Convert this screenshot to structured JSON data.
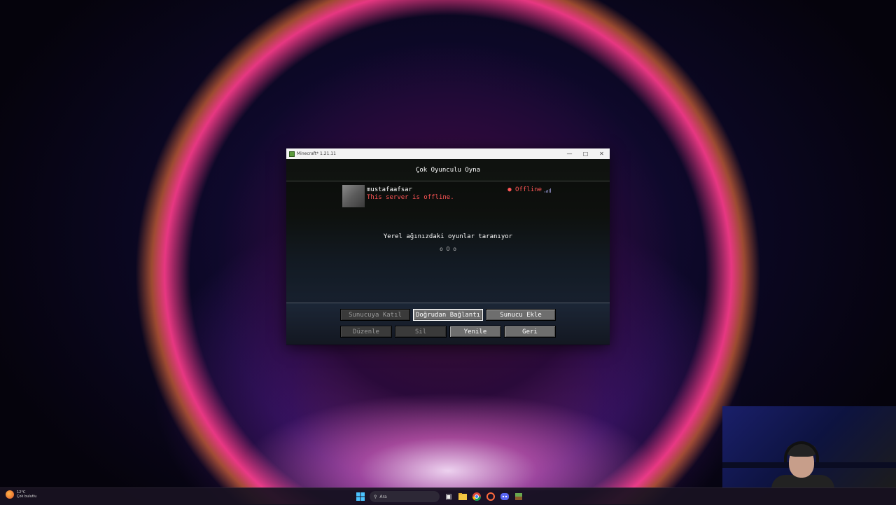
{
  "window": {
    "title": "Minecraft* 1.21.11",
    "minimize": "—",
    "maximize": "□",
    "close": "✕"
  },
  "minecraft": {
    "header": "Çok Oyunculu Oyna",
    "server": {
      "name": "mustafaafsar",
      "motd": "This server is offline.",
      "status": "● Offline"
    },
    "scanning_text": "Yerel ağınızdaki oyunlar taranıyor",
    "scanning_dots": "o O o",
    "buttons": {
      "join": "Sunucuya Katıl",
      "direct": "Doğrudan Bağlantı",
      "add": "Sunucu Ekle",
      "edit": "Düzenle",
      "delete": "Sil",
      "refresh": "Yenile",
      "back": "Geri"
    }
  },
  "taskbar": {
    "weather_temp": "12°C",
    "weather_desc": "Çok bulutlu",
    "search_placeholder": "Ara",
    "start_icon": "windows-start-icon",
    "pinned_icons": [
      "file-explorer-icon",
      "chrome-icon",
      "app-icon",
      "discord-icon",
      "minecraft-icon"
    ]
  }
}
